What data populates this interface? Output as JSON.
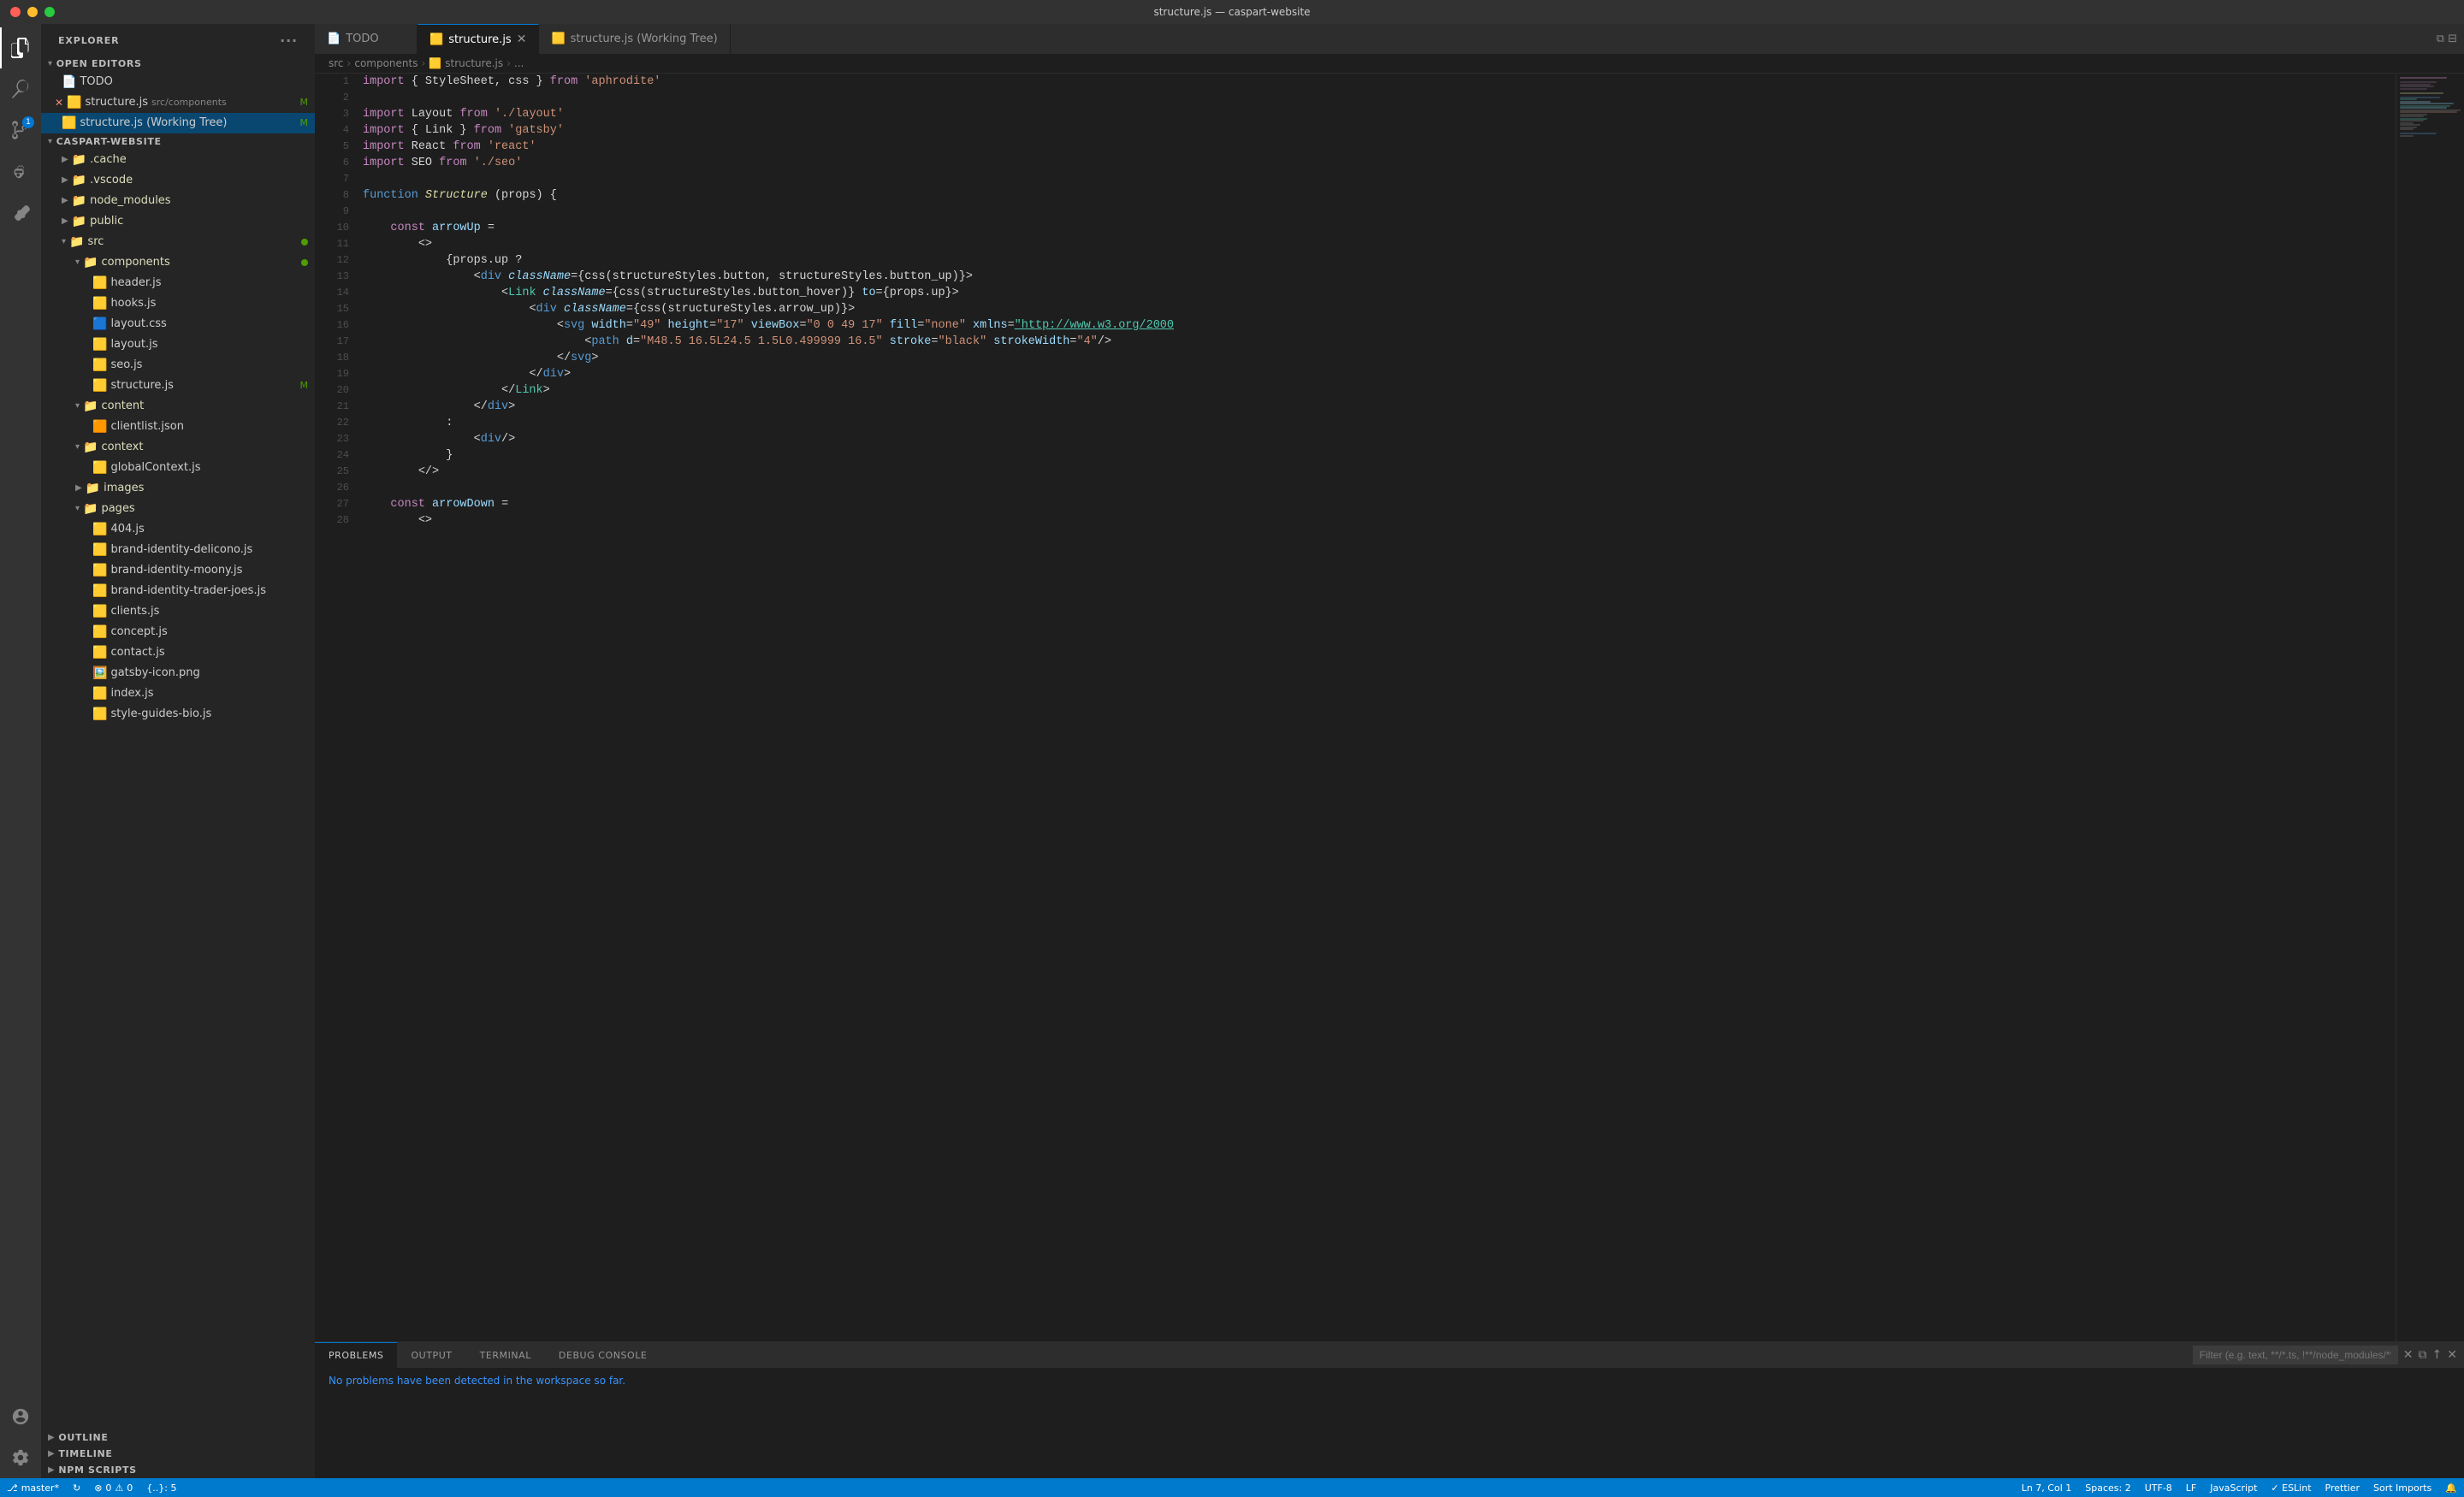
{
  "titleBar": {
    "title": "structure.js — caspart-website"
  },
  "tabs": [
    {
      "id": "todo",
      "label": "TODO",
      "icon": "📄",
      "active": false,
      "modified": false
    },
    {
      "id": "structure-js",
      "label": "structure.js",
      "icon": "🟨",
      "active": true,
      "modified": false,
      "closeable": true
    },
    {
      "id": "structure-working",
      "label": "structure.js (Working Tree)",
      "icon": "🟨",
      "active": false,
      "modified": false
    }
  ],
  "breadcrumb": {
    "parts": [
      "src",
      "components",
      "structure.js",
      "..."
    ]
  },
  "sidebar": {
    "header": "EXPLORER",
    "sections": {
      "openEditors": {
        "label": "OPEN EDITORS",
        "files": [
          {
            "name": "TODO",
            "icon": "📄",
            "color": "#cccccc"
          },
          {
            "name": "structure.js",
            "path": "src/components",
            "icon": "🟨",
            "modified": "M",
            "hasX": true
          },
          {
            "name": "structure.js (Working Tree)",
            "icon": "🟨",
            "modified": "M",
            "isActive": true
          }
        ]
      },
      "project": {
        "label": "CASPART-WEBSITE",
        "hasDot": true,
        "items": [
          {
            "name": ".cache",
            "icon": "📁",
            "type": "folder",
            "level": 1
          },
          {
            "name": ".vscode",
            "icon": "📁",
            "type": "folder",
            "level": 1,
            "isVscode": true
          },
          {
            "name": "node_modules",
            "icon": "📁",
            "type": "folder",
            "level": 1
          },
          {
            "name": "public",
            "icon": "📁",
            "type": "folder",
            "level": 1
          },
          {
            "name": "src",
            "icon": "📁",
            "type": "folder",
            "level": 1,
            "hasDot": true,
            "expanded": true
          },
          {
            "name": "components",
            "icon": "📁",
            "type": "folder",
            "level": 2,
            "hasDot": true,
            "expanded": true
          },
          {
            "name": "header.js",
            "icon": "🟨",
            "type": "file",
            "level": 3
          },
          {
            "name": "hooks.js",
            "icon": "🟨",
            "type": "file",
            "level": 3
          },
          {
            "name": "layout.css",
            "icon": "🟦",
            "type": "file",
            "level": 3
          },
          {
            "name": "layout.js",
            "icon": "🟨",
            "type": "file",
            "level": 3
          },
          {
            "name": "seo.js",
            "icon": "🟨",
            "type": "file",
            "level": 3
          },
          {
            "name": "structure.js",
            "icon": "🟨",
            "type": "file",
            "level": 3,
            "modified": "M"
          },
          {
            "name": "content",
            "icon": "📁",
            "type": "folder",
            "level": 2,
            "expanded": true
          },
          {
            "name": "clientlist.json",
            "icon": "🟧",
            "type": "file",
            "level": 3
          },
          {
            "name": "context",
            "icon": "📁",
            "type": "folder",
            "level": 2,
            "expanded": true
          },
          {
            "name": "globalContext.js",
            "icon": "🟨",
            "type": "file",
            "level": 3
          },
          {
            "name": "images",
            "icon": "📁",
            "type": "folder",
            "level": 2,
            "expanded": false
          },
          {
            "name": "pages",
            "icon": "📁",
            "type": "folder",
            "level": 2,
            "expanded": true
          },
          {
            "name": "404.js",
            "icon": "🟨",
            "type": "file",
            "level": 3
          },
          {
            "name": "brand-identity-delicono.js",
            "icon": "🟨",
            "type": "file",
            "level": 3
          },
          {
            "name": "brand-identity-moony.js",
            "icon": "🟨",
            "type": "file",
            "level": 3
          },
          {
            "name": "brand-identity-trader-joes.js",
            "icon": "🟨",
            "type": "file",
            "level": 3
          },
          {
            "name": "clients.js",
            "icon": "🟨",
            "type": "file",
            "level": 3
          },
          {
            "name": "concept.js",
            "icon": "🟨",
            "type": "file",
            "level": 3
          },
          {
            "name": "contact.js",
            "icon": "🟨",
            "type": "file",
            "level": 3
          },
          {
            "name": "gatsby-icon.png",
            "icon": "🖼️",
            "type": "file",
            "level": 3
          },
          {
            "name": "index.js",
            "icon": "🟨",
            "type": "file",
            "level": 3
          },
          {
            "name": "style-guides-bio.js",
            "icon": "🟨",
            "type": "file",
            "level": 3
          }
        ]
      },
      "outline": {
        "label": "OUTLINE"
      },
      "timeline": {
        "label": "TIMELINE"
      },
      "npmScripts": {
        "label": "NPM SCRIPTS"
      }
    }
  },
  "codeLines": [
    {
      "num": 1,
      "html": "<span class='kw'>import</span> <span class='plain'>{ StyleSheet, css }</span> <span class='kw'>from</span> <span class='str'>'aphrodite'</span>"
    },
    {
      "num": 2,
      "html": ""
    },
    {
      "num": 3,
      "html": "<span class='kw'>import</span> <span class='plain'>Layout</span> <span class='kw'>from</span> <span class='str'>'./layout'</span>"
    },
    {
      "num": 4,
      "html": "<span class='kw'>import</span> <span class='plain'>{ Link }</span> <span class='kw'>from</span> <span class='str'>'gatsby'</span>"
    },
    {
      "num": 5,
      "html": "<span class='kw'>import</span> <span class='plain'>React</span> <span class='kw'>from</span> <span class='str'>'react'</span>"
    },
    {
      "num": 6,
      "html": "<span class='kw'>import</span> <span class='plain'>SEO</span> <span class='kw'>from</span> <span class='str'>'./seo'</span>"
    },
    {
      "num": 7,
      "html": ""
    },
    {
      "num": 8,
      "html": "<span class='kw2'>function</span> <span class='fn it'>Structure</span> <span class='plain'>(props) {</span>"
    },
    {
      "num": 9,
      "html": ""
    },
    {
      "num": 10,
      "html": "    <span class='kw'>const</span> <span class='prop'>arrowUp</span> <span class='plain'>=</span>"
    },
    {
      "num": 11,
      "html": "        <span class='plain'>&lt;&gt;</span>"
    },
    {
      "num": 12,
      "html": "            <span class='plain'>{props.up ?</span>"
    },
    {
      "num": 13,
      "html": "                <span class='plain'>&lt;</span><span class='kw2'>div</span> <span class='attr it'>className</span><span class='plain'>={css(structureStyles.button, structureStyles.button_up)}&gt;</span>"
    },
    {
      "num": 14,
      "html": "                    <span class='plain'>&lt;</span><span class='tag'>Link</span> <span class='attr it'>className</span><span class='plain'>={css(structureStyles.button_hover)}</span> <span class='attr'>to</span><span class='plain'>={props.up}&gt;</span>"
    },
    {
      "num": 15,
      "html": "                        <span class='plain'>&lt;</span><span class='kw2'>div</span> <span class='attr it'>className</span><span class='plain'>={css(structureStyles.arrow_up)}&gt;</span>"
    },
    {
      "num": 16,
      "html": "                            <span class='plain'>&lt;</span><span class='kw2'>svg</span> <span class='attr'>width</span><span class='plain'>=</span><span class='str'>\"49\"</span> <span class='attr'>height</span><span class='plain'>=</span><span class='str'>\"17\"</span> <span class='attr'>viewBox</span><span class='plain'>=</span><span class='str'>\"0 0 49 17\"</span> <span class='attr'>fill</span><span class='plain'>=</span><span class='str'>\"none\"</span> <span class='attr'>xmlns</span><span class='plain'>=</span><span class='url-link'>\"http://www.w3.org/2000</span>"
    },
    {
      "num": 17,
      "html": "                                <span class='plain'>&lt;</span><span class='kw2'>path</span> <span class='attr'>d</span><span class='plain'>=</span><span class='str'>\"M48.5 16.5L24.5 1.5L0.499999 16.5\"</span> <span class='attr'>stroke</span><span class='plain'>=</span><span class='str'>\"black\"</span> <span class='attr'>strokeWidth</span><span class='plain'>=</span><span class='str'>\"4\"</span><span class='plain'>/&gt;</span>"
    },
    {
      "num": 18,
      "html": "                            <span class='plain'>&lt;/</span><span class='kw2'>svg</span><span class='plain'>&gt;</span>"
    },
    {
      "num": 19,
      "html": "                        <span class='plain'>&lt;/</span><span class='kw2'>div</span><span class='plain'>&gt;</span>"
    },
    {
      "num": 20,
      "html": "                    <span class='plain'>&lt;/</span><span class='tag'>Link</span><span class='plain'>&gt;</span>"
    },
    {
      "num": 21,
      "html": "                <span class='plain'>&lt;/</span><span class='kw2'>div</span><span class='plain'>&gt;</span>"
    },
    {
      "num": 22,
      "html": "            <span class='plain'>:</span>"
    },
    {
      "num": 23,
      "html": "                <span class='plain'>&lt;</span><span class='kw2'>div</span><span class='plain'>/&gt;</span>"
    },
    {
      "num": 24,
      "html": "            <span class='plain'>}</span>"
    },
    {
      "num": 25,
      "html": "        <span class='plain'>&lt;/&gt;</span>"
    },
    {
      "num": 26,
      "html": ""
    },
    {
      "num": 27,
      "html": "    <span class='kw'>const</span> <span class='prop'>arrowDown</span> <span class='plain'>=</span>"
    },
    {
      "num": 28,
      "html": "        <span class='plain'>&lt;&gt;</span>"
    }
  ],
  "panels": {
    "tabs": [
      "PROBLEMS",
      "OUTPUT",
      "TERMINAL",
      "DEBUG CONSOLE"
    ],
    "activeTab": "PROBLEMS",
    "filterPlaceholder": "Filter (e.g. text, **/*.ts, !**/node_modules/**)",
    "content": "No problems have been detected in the workspace so far."
  },
  "statusBar": {
    "branch": "master*",
    "sync": "↻",
    "errors": "⊗ 0",
    "warnings": "⚠ 0",
    "jsxBraces": "{..}: 5",
    "position": "Ln 7, Col 1",
    "spaces": "Spaces: 2",
    "encoding": "UTF-8",
    "lineEnding": "LF",
    "language": "JavaScript",
    "eslint": "✓ ESLint",
    "prettier": "Prettier",
    "sortImports": "Sort Imports"
  }
}
